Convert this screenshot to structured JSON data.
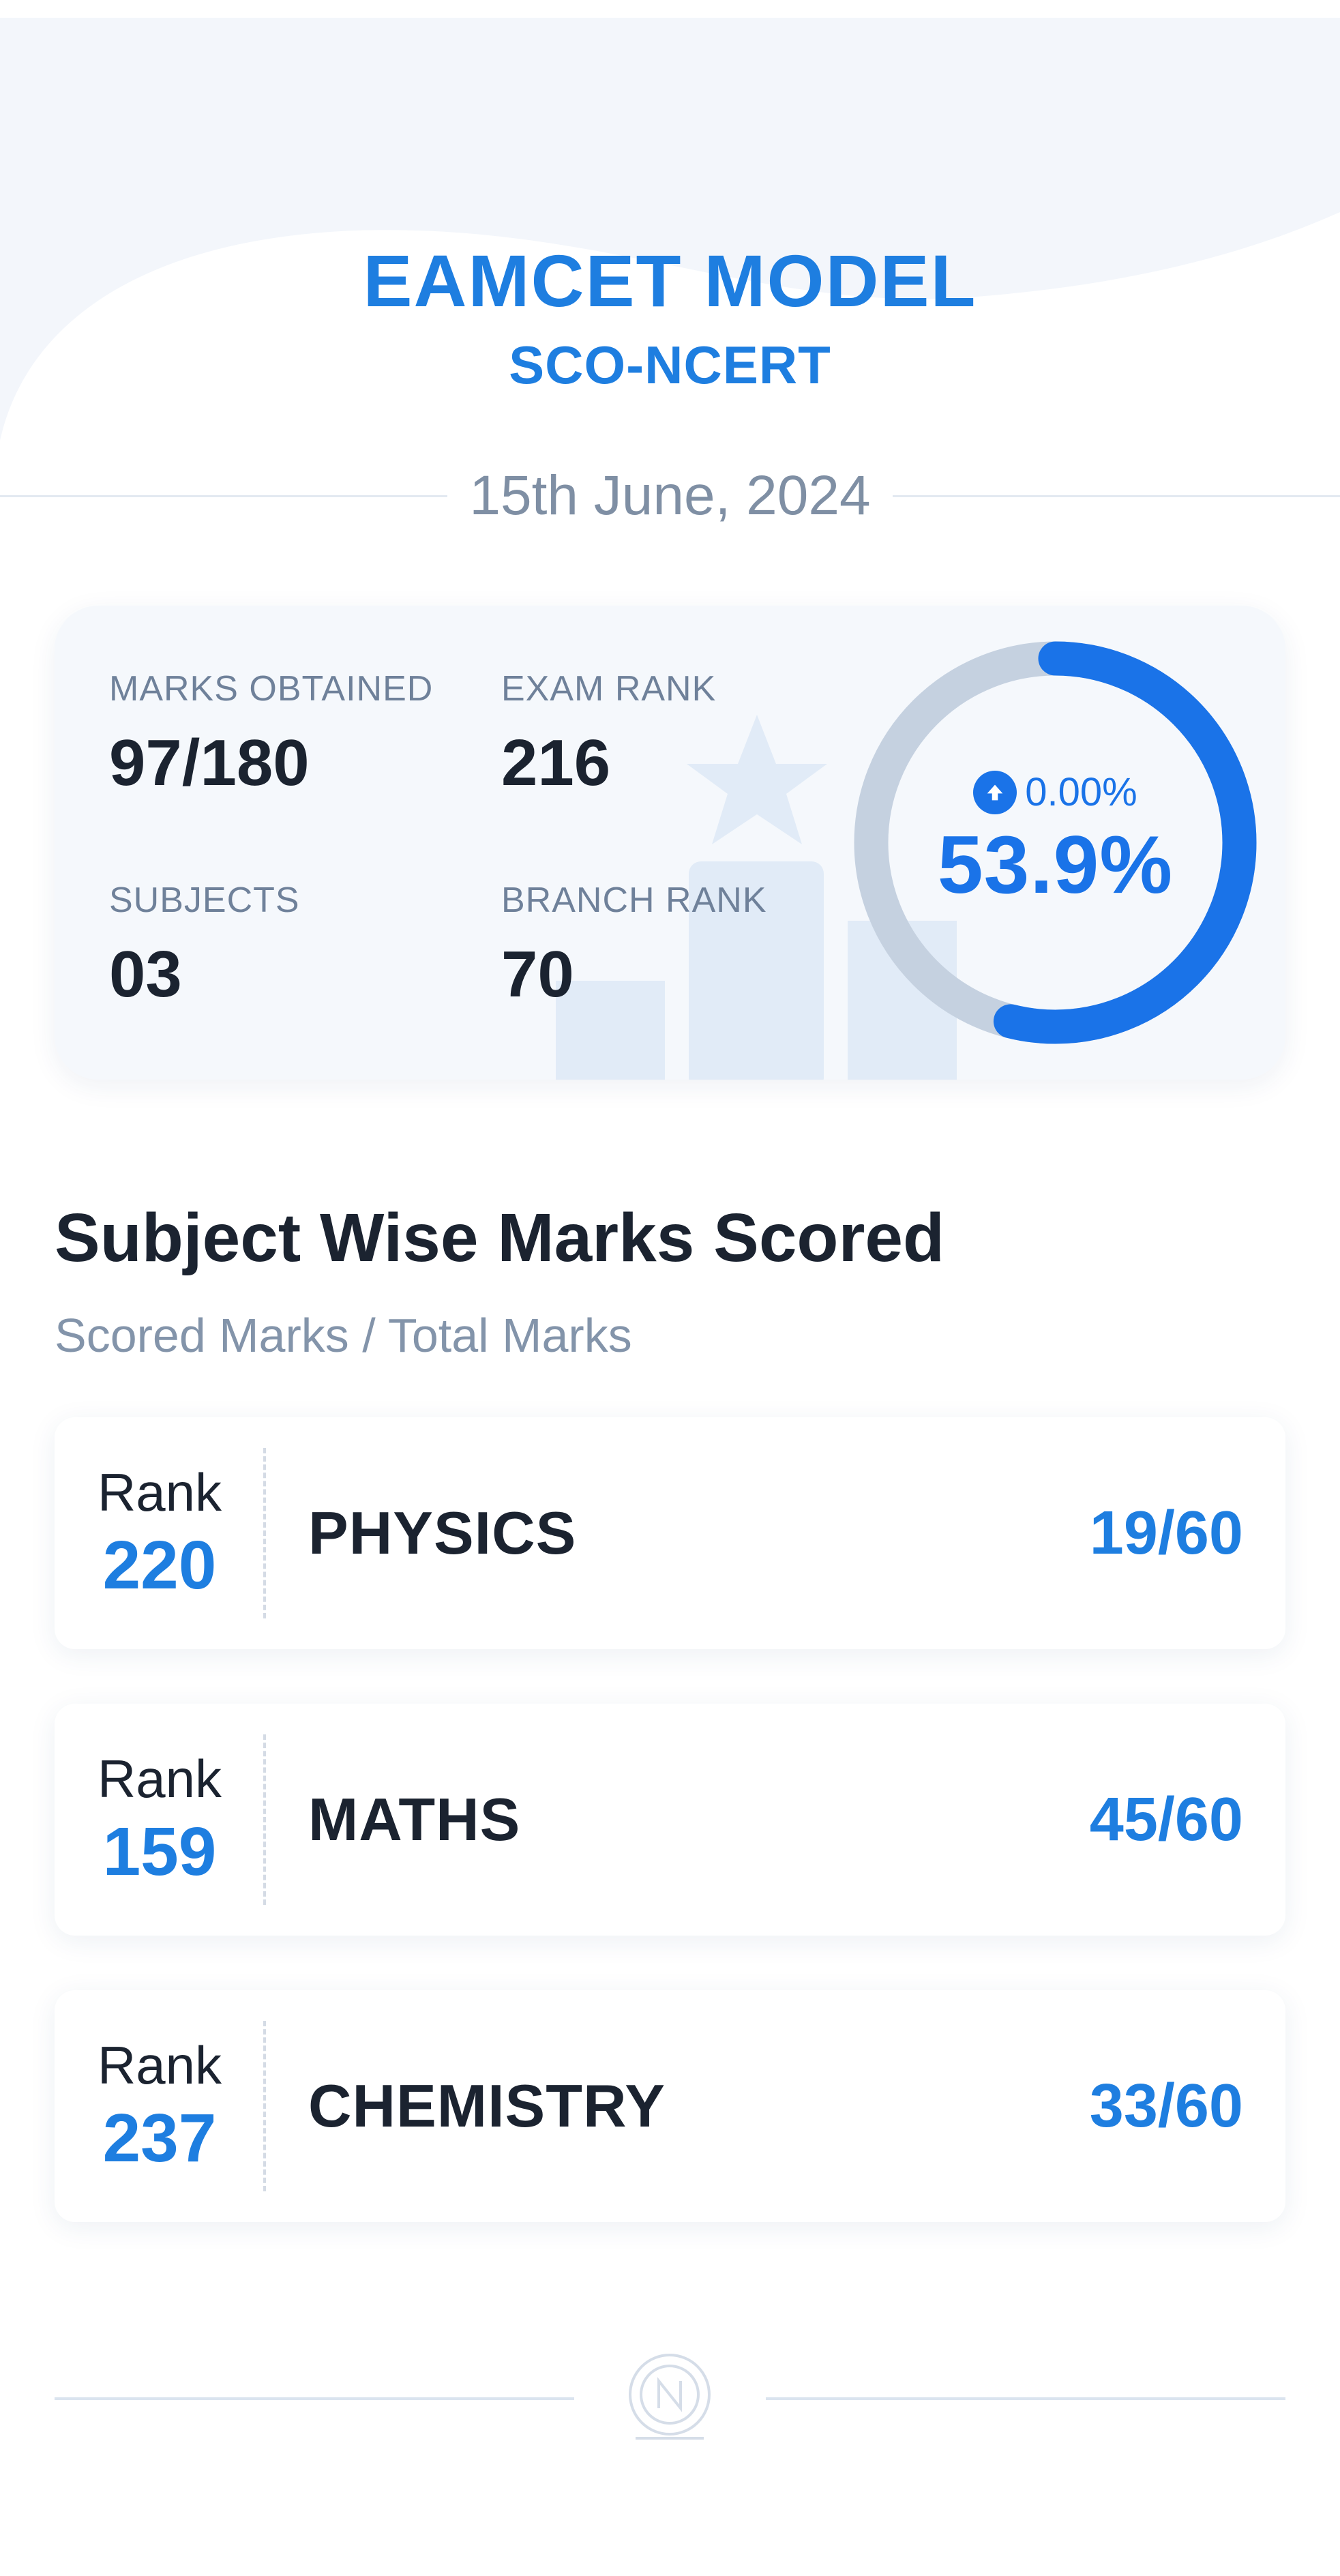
{
  "header": {
    "title": "EAMCET MODEL",
    "subtitle": "SCO-NCERT",
    "date": "15th June, 2024"
  },
  "summary": {
    "marks_obtained": {
      "label": "MARKS OBTAINED",
      "value": "97/180"
    },
    "exam_rank": {
      "label": "EXAM RANK",
      "value": "216"
    },
    "subjects": {
      "label": "SUBJECTS",
      "value": "03"
    },
    "branch_rank": {
      "label": "BRANCH RANK",
      "value": "70"
    },
    "change_text": "0.00%",
    "percentage_text": "53.9%",
    "percentage_value": 53.9
  },
  "section": {
    "title": "Subject Wise Marks Scored",
    "subtitle": "Scored Marks / Total Marks"
  },
  "subjects": [
    {
      "rank_label": "Rank",
      "rank": "220",
      "name": "PHYSICS",
      "score": "19/60"
    },
    {
      "rank_label": "Rank",
      "rank": "159",
      "name": "MATHS",
      "score": "45/60"
    },
    {
      "rank_label": "Rank",
      "rank": "237",
      "name": "CHEMISTRY",
      "score": "33/60"
    }
  ],
  "icons": {
    "change": "arrow-up-circle-icon",
    "footer": "logo-icon"
  },
  "colors": {
    "accent": "#1e7ee0",
    "ring": "#1a73e8",
    "ring_track": "#c5d1e0",
    "text": "#1b2330",
    "muted": "#7f8fa4"
  }
}
